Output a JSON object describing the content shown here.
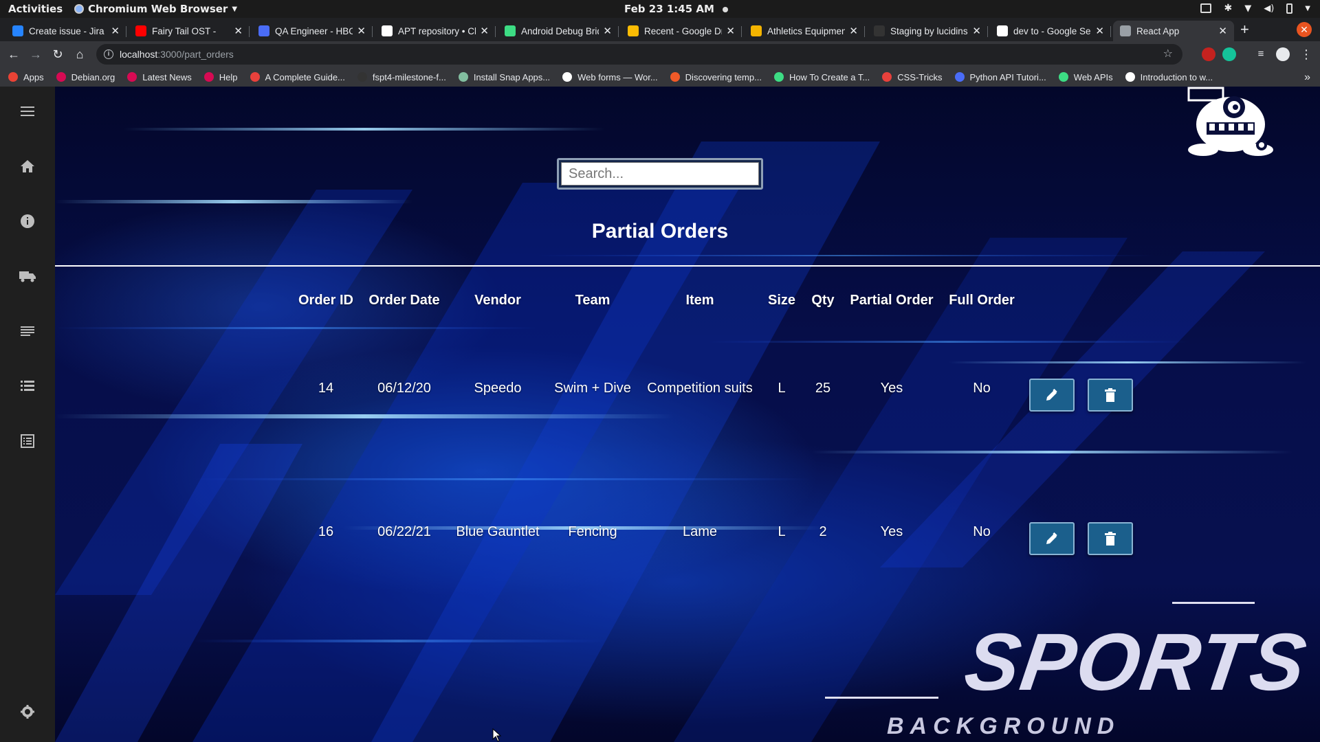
{
  "os_bar": {
    "activities": "Activities",
    "app_menu": "Chromium Web Browser",
    "clock": "Feb 23  1:45 AM"
  },
  "browser": {
    "tabs": [
      {
        "title": "Create issue - Jira",
        "color": "#2684ff"
      },
      {
        "title": "Fairy Tail OST - ",
        "color": "#ff0000"
      },
      {
        "title": "QA Engineer - HBO",
        "color": "#4a6cf7"
      },
      {
        "title": "APT repository • Ch",
        "color": "#ffffff"
      },
      {
        "title": "Android Debug Brid",
        "color": "#3ddc84"
      },
      {
        "title": "Recent - Google Dri",
        "color": "#fbbc04"
      },
      {
        "title": "Athletics Equipmen",
        "color": "#f4b400"
      },
      {
        "title": "Staging by lucidins",
        "color": "#333333"
      },
      {
        "title": "dev to - Google Sea",
        "color": "#ffffff"
      },
      {
        "title": "React App",
        "color": "#9aa0a6"
      }
    ],
    "url_host": "localhost",
    "url_path": ":3000/part_orders",
    "bookmarks": [
      {
        "label": "Apps",
        "color": "#ea4335"
      },
      {
        "label": "Debian.org",
        "color": "#d70a53"
      },
      {
        "label": "Latest News",
        "color": "#d70a53"
      },
      {
        "label": "Help",
        "color": "#d70a53"
      },
      {
        "label": "A Complete Guide...",
        "color": "#e8413c"
      },
      {
        "label": "fspt4-milestone-f...",
        "color": "#333333"
      },
      {
        "label": "Install Snap Apps...",
        "color": "#82bea0"
      },
      {
        "label": "Web forms — Wor...",
        "color": "#ffffff"
      },
      {
        "label": "Discovering temp...",
        "color": "#f05a28"
      },
      {
        "label": "How To Create a T...",
        "color": "#3ddc84"
      },
      {
        "label": "CSS-Tricks",
        "color": "#e8413c"
      },
      {
        "label": "Python API Tutori...",
        "color": "#4a6cf7"
      },
      {
        "label": "Web APIs",
        "color": "#3ddc84"
      },
      {
        "label": "Introduction to w...",
        "color": "#ffffff"
      }
    ]
  },
  "sidebar": {
    "items": [
      "menu-icon",
      "home-icon",
      "info-icon",
      "truck-icon",
      "list-icon",
      "list-bulleted-icon",
      "form-list-icon",
      "gear-icon"
    ]
  },
  "page": {
    "search_placeholder": "Search...",
    "title": "Partial Orders",
    "columns": [
      "Order ID",
      "Order Date",
      "Vendor",
      "Team",
      "Item",
      "Size",
      "Qty",
      "Partial Order",
      "Full Order"
    ],
    "rows": [
      [
        "14",
        "06/12/20",
        "Speedo",
        "Swim + Dive",
        "Competition suits",
        "L",
        "25",
        "Yes",
        "No"
      ],
      [
        "16",
        "06/22/21",
        "Blue Gauntlet",
        "Fencing",
        "Lame",
        "L",
        "2",
        "Yes",
        "No"
      ]
    ],
    "actions": [
      "edit-icon",
      "delete-icon"
    ]
  },
  "background_art": {
    "headline": "SPORTS",
    "subline": "BACKGROUND"
  },
  "colors": {
    "button_bg": "#1b5f8c",
    "page_bg": "#060e4a"
  }
}
